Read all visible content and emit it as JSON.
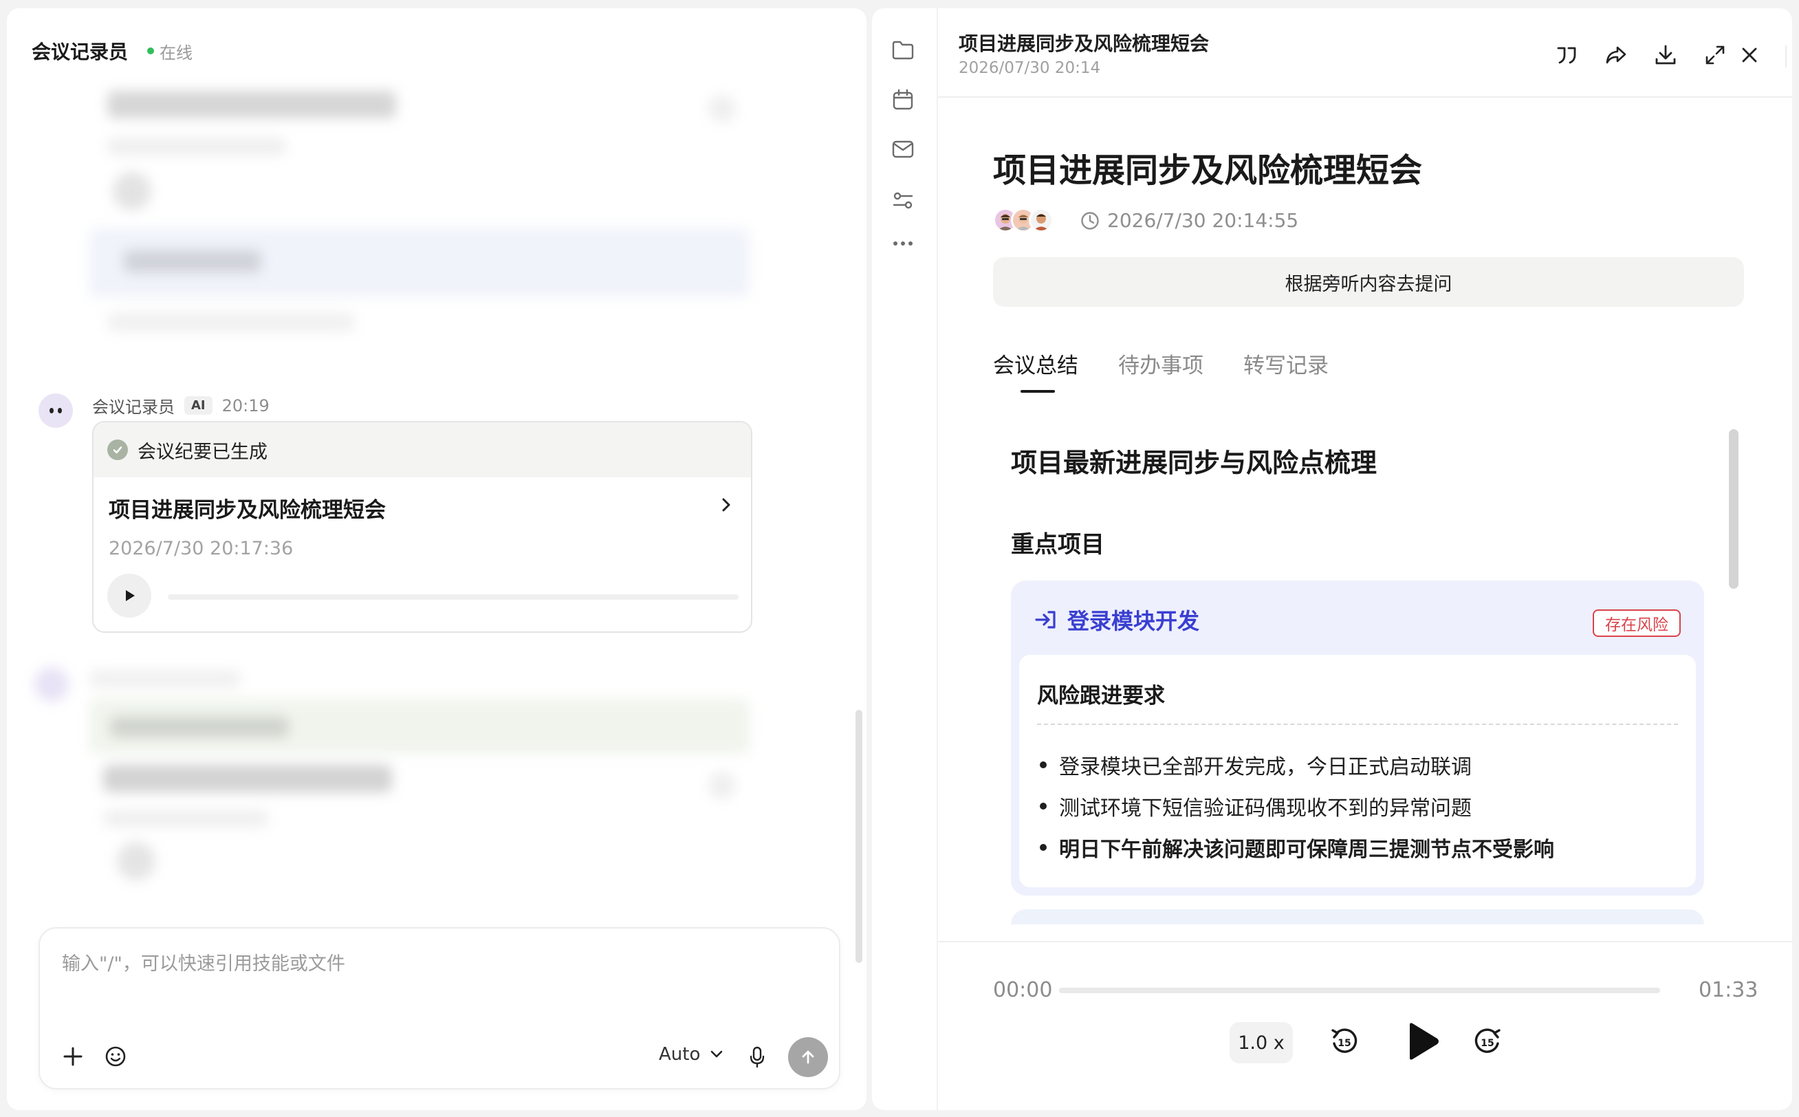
{
  "left": {
    "bot_name": "会议记录员",
    "status": "在线",
    "message": {
      "sender": "会议记录员",
      "badge": "AI",
      "time": "20:19",
      "card": {
        "header": "会议纪要已生成",
        "title": "项目进展同步及风险梳理短会",
        "date": "2026/7/30 20:17:36"
      }
    },
    "composer": {
      "placeholder": "输入\"/\"，可以快速引用技能或文件",
      "model": "Auto"
    }
  },
  "right": {
    "header": {
      "title": "项目进展同步及风险梳理短会",
      "date": "2026/07/30 20:14"
    },
    "doc": {
      "title": "项目进展同步及风险梳理短会",
      "time": "2026/7/30 20:14:55",
      "ask_button": "根据旁听内容去提问",
      "tabs": [
        {
          "label": "会议总结"
        },
        {
          "label": "待办事项"
        },
        {
          "label": "转写记录"
        }
      ],
      "section_title": "项目最新进展同步与风险点梳理",
      "subsection_title": "重点项目",
      "project": {
        "name": "登录模块开发",
        "tag": "存在风险",
        "inner_title": "风险跟进要求",
        "items": [
          "登录模块已全部开发完成，今日正式启动联调",
          "测试环境下短信验证码偶现收不到的异常问题",
          "明日下午前解决该问题即可保障周三提测节点不受影响"
        ]
      }
    },
    "player": {
      "current": "00:00",
      "total": "01:33",
      "speed": "1.0 x",
      "progress": 0
    }
  },
  "colors": {
    "accent_blue": "#3a3fd1",
    "risk_red": "#d9434b",
    "online_green": "#2fbf5b"
  },
  "icons": {
    "rail": [
      "folder-icon",
      "calendar-icon",
      "mail-icon",
      "filter-icon",
      "more-icon"
    ],
    "header": [
      "quote-icon",
      "share-icon",
      "download-icon",
      "expand-icon",
      "close-icon"
    ]
  }
}
